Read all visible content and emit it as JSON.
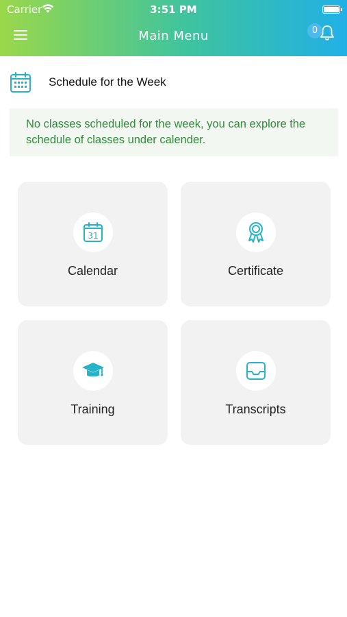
{
  "status_bar": {
    "carrier": "Carrier",
    "time": "3:51 PM"
  },
  "header": {
    "title": "Main Menu",
    "notification_count": "0"
  },
  "schedule": {
    "title": "Schedule for the Week",
    "notice": "No classes scheduled for the week, you can explore the schedule of classes under calender."
  },
  "tiles": [
    {
      "label": "Calendar",
      "icon": "calendar-icon",
      "icon_text": "31"
    },
    {
      "label": "Certificate",
      "icon": "certificate-icon"
    },
    {
      "label": "Training",
      "icon": "graduation-cap-icon"
    },
    {
      "label": "Transcripts",
      "icon": "inbox-tray-icon"
    }
  ],
  "colors": {
    "accent": "#26b3c8",
    "notice_text": "#2e8b3a",
    "notice_bg": "#f2f8f1",
    "tile_bg": "#f2f2f2",
    "badge": "#4fb9e9",
    "gradient_start": "#9ad84a",
    "gradient_end": "#21b0e6"
  }
}
